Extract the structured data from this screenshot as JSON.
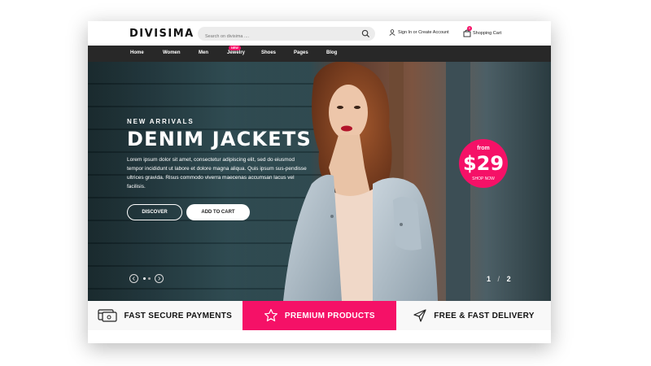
{
  "header": {
    "logo": "DIVISIMA",
    "search_placeholder": "Search on divisima ....",
    "account_label": "Sign In or Create Account",
    "cart_label": "Shopping Cart",
    "cart_count": "0"
  },
  "nav": {
    "items": [
      "Home",
      "Women",
      "Men",
      "Jewelry",
      "Shoes",
      "Pages",
      "Blog"
    ],
    "badge": "NEW"
  },
  "hero": {
    "kicker": "NEW ARRIVALS",
    "title": "DENIM JACKETS",
    "description": "Lorem ipsum dolor sit amet, consectetur adipiscing elit, sed do eiusmod tempor incididunt ut labore et dolore magna aliqua. Quis ipsum sus-pendisse ultrices gravida. Risus commodo viverra maecenas accumsan lacus vel facilisis.",
    "discover_label": "DISCOVER",
    "add_to_cart_label": "ADD TO CART",
    "price_from": "from",
    "price": "$29",
    "shop_now": "SHOP NOW",
    "slide_current": "1",
    "slide_total": "2"
  },
  "features": [
    {
      "label": "FAST SECURE PAYMENTS",
      "icon": "card-icon"
    },
    {
      "label": "PREMIUM PRODUCTS",
      "icon": "star-icon"
    },
    {
      "label": "FREE & FAST DELIVERY",
      "icon": "send-icon"
    }
  ],
  "colors": {
    "accent": "#f51167",
    "nav_bg": "#282828"
  }
}
